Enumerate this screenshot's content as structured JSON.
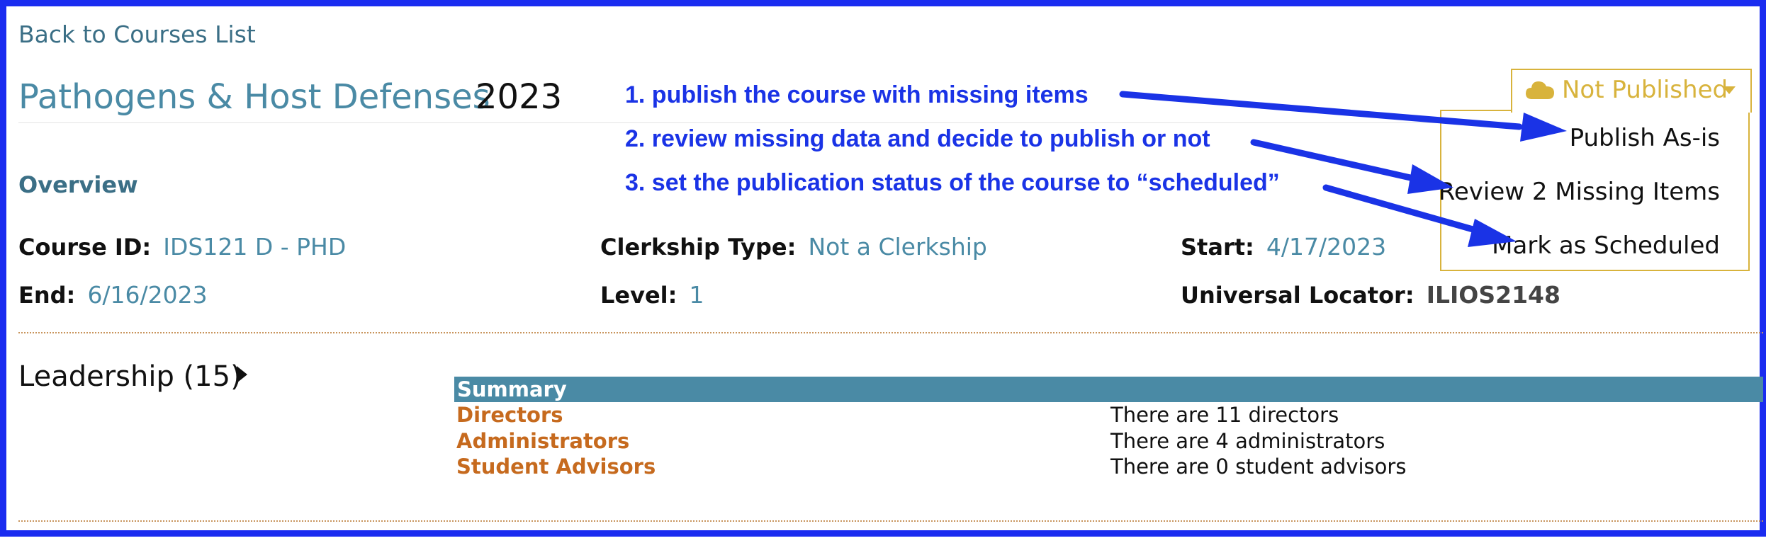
{
  "nav": {
    "back_label": "Back to Courses List"
  },
  "course": {
    "title": "Pathogens & Host Defenses",
    "year": "2023"
  },
  "overview": {
    "heading": "Overview",
    "course_id_label": "Course ID:",
    "course_id_value": "IDS121 D - PHD",
    "clerkship_label": "Clerkship Type:",
    "clerkship_value": "Not a Clerkship",
    "start_label": "Start:",
    "start_value": "4/17/2023",
    "end_label": "End:",
    "end_value": "6/16/2023",
    "level_label": "Level:",
    "level_value": "1",
    "locator_label": "Universal Locator:",
    "locator_value": "ILIOS2148"
  },
  "leadership": {
    "heading": "Leadership (15)",
    "summary_header": "Summary",
    "rows": [
      {
        "role": "Directors",
        "value": "There are 11 directors"
      },
      {
        "role": "Administrators",
        "value": "There are 4 administrators"
      },
      {
        "role": "Student Advisors",
        "value": "There are 0 student advisors"
      }
    ]
  },
  "publish": {
    "button_label": "Not Published",
    "icon": "cloud-icon",
    "menu": [
      "Publish As-is",
      "Review 2 Missing Items",
      "Mark as Scheduled"
    ]
  },
  "annotations": [
    "1. publish the course with missing items",
    "2. review missing data and decide to publish or not",
    "3. set the publication status of the course to “scheduled”"
  ],
  "colors": {
    "frame": "#1a2cf0",
    "link": "#4a8aa5",
    "accent_gold": "#d8b33c",
    "role_orange": "#c66a1e",
    "annotation_blue": "#1a33e6"
  }
}
